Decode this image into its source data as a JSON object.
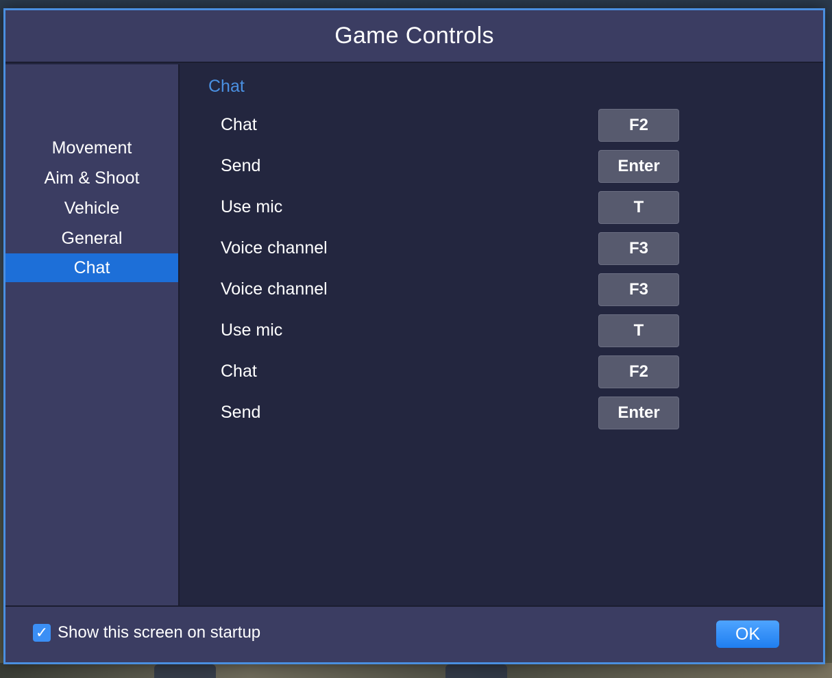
{
  "window": {
    "title": "Game Controls"
  },
  "sidebar": {
    "items": [
      {
        "label": "Movement",
        "active": false
      },
      {
        "label": "Aim & Shoot",
        "active": false
      },
      {
        "label": "Vehicle",
        "active": false
      },
      {
        "label": "General",
        "active": false
      },
      {
        "label": "Chat",
        "active": true
      }
    ]
  },
  "section": {
    "title": "Chat",
    "bindings": [
      {
        "action": "Chat",
        "key": "F2"
      },
      {
        "action": "Send",
        "key": "Enter"
      },
      {
        "action": "Use mic",
        "key": "T"
      },
      {
        "action": "Voice channel",
        "key": "F3"
      },
      {
        "action": "Voice channel",
        "key": "F3"
      },
      {
        "action": "Use mic",
        "key": "T"
      },
      {
        "action": "Chat",
        "key": "F2"
      },
      {
        "action": "Send",
        "key": "Enter"
      }
    ]
  },
  "footer": {
    "startup_label": "Show this screen on startup",
    "startup_checked": true,
    "ok_label": "OK"
  },
  "colors": {
    "accent": "#1d6fd8",
    "panel": "#3b3d62",
    "content_bg": "#23263f",
    "section_title": "#4a90e2",
    "key_button": "#575a6e"
  }
}
